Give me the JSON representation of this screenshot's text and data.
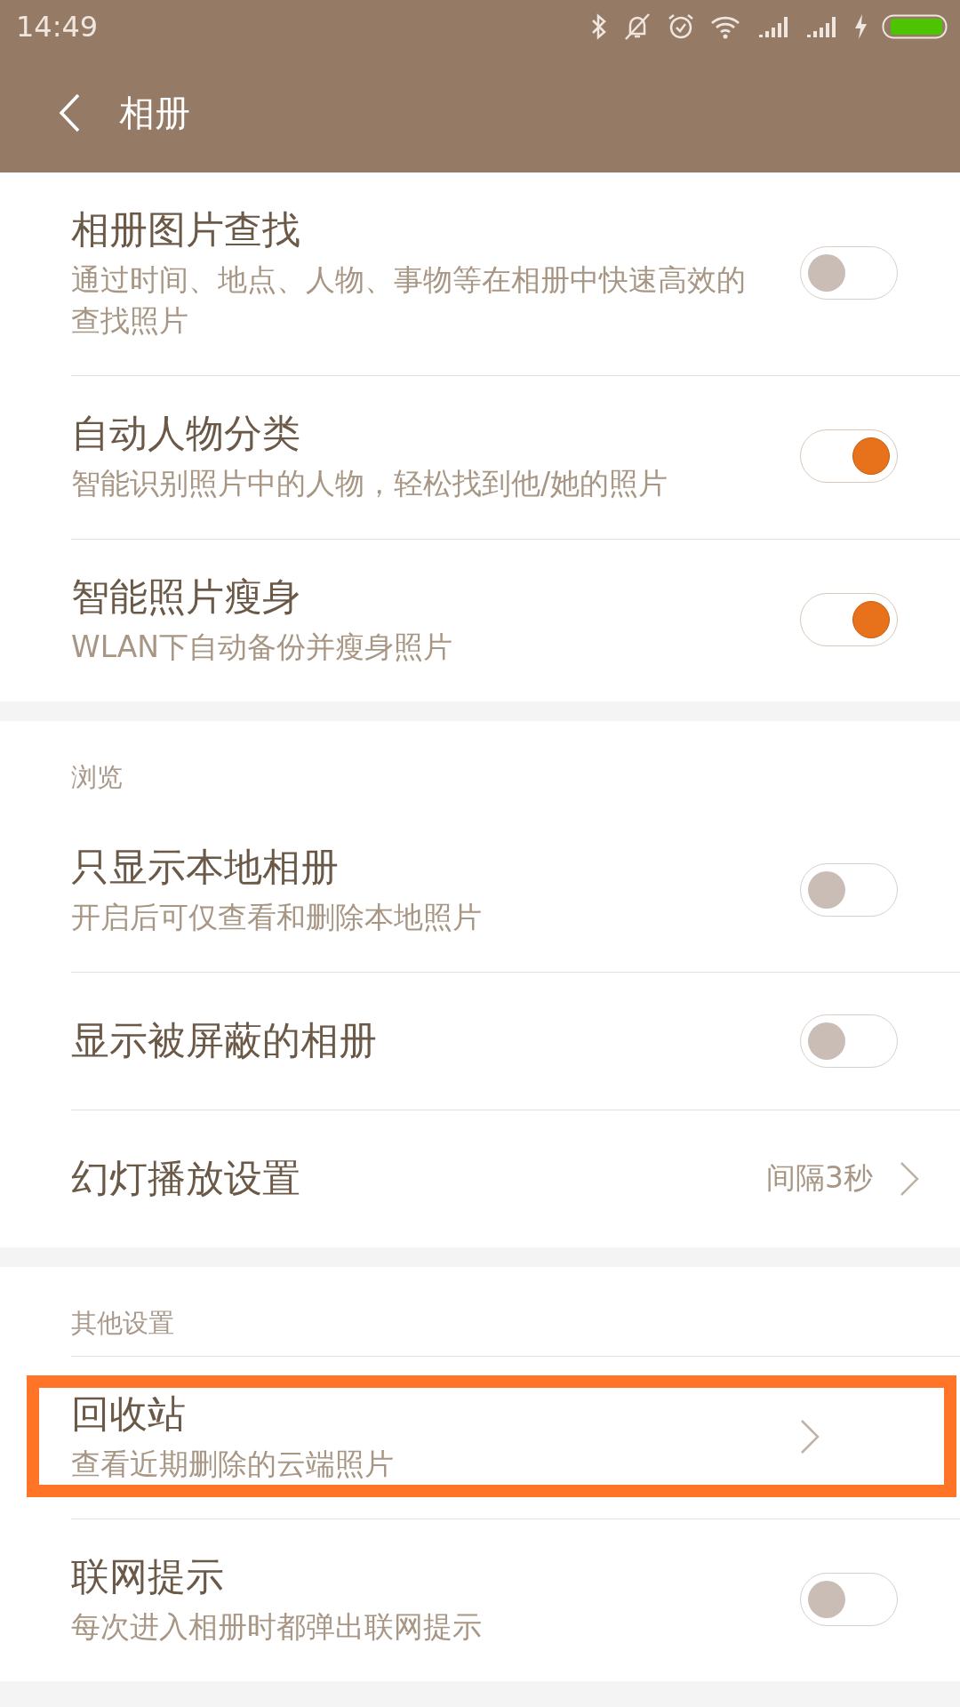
{
  "status_bar": {
    "time": "14:49"
  },
  "header": {
    "title": "相册"
  },
  "sections": [
    {
      "items": [
        {
          "kind": "toggle",
          "title": "相册图片查找",
          "subtitle": "通过时间、地点、人物、事物等在相册中快速高效的查找照片",
          "on": false,
          "highlighted": false
        },
        {
          "kind": "toggle",
          "title": "自动人物分类",
          "subtitle": "智能识别照片中的人物，轻松找到他/她的照片",
          "on": true,
          "highlighted": false
        },
        {
          "kind": "toggle",
          "title": "智能照片瘦身",
          "subtitle": "WLAN下自动备份并瘦身照片",
          "on": true,
          "highlighted": false
        }
      ]
    },
    {
      "header": "浏览",
      "items": [
        {
          "kind": "toggle",
          "title": "只显示本地相册",
          "subtitle": "开启后可仅查看和删除本地照片",
          "on": false,
          "highlighted": false
        },
        {
          "kind": "toggle",
          "title": "显示被屏蔽的相册",
          "on": false,
          "highlighted": false
        },
        {
          "kind": "link",
          "title": "幻灯播放设置",
          "value": "间隔3秒",
          "highlighted": false
        }
      ]
    },
    {
      "header": "其他设置",
      "items": [
        {
          "kind": "link",
          "title": "回收站",
          "subtitle": "查看近期删除的云端照片",
          "highlighted": true
        },
        {
          "kind": "toggle",
          "title": "联网提示",
          "subtitle": "每次进入相册时都弹出联网提示",
          "on": false,
          "highlighted": false
        }
      ]
    }
  ]
}
